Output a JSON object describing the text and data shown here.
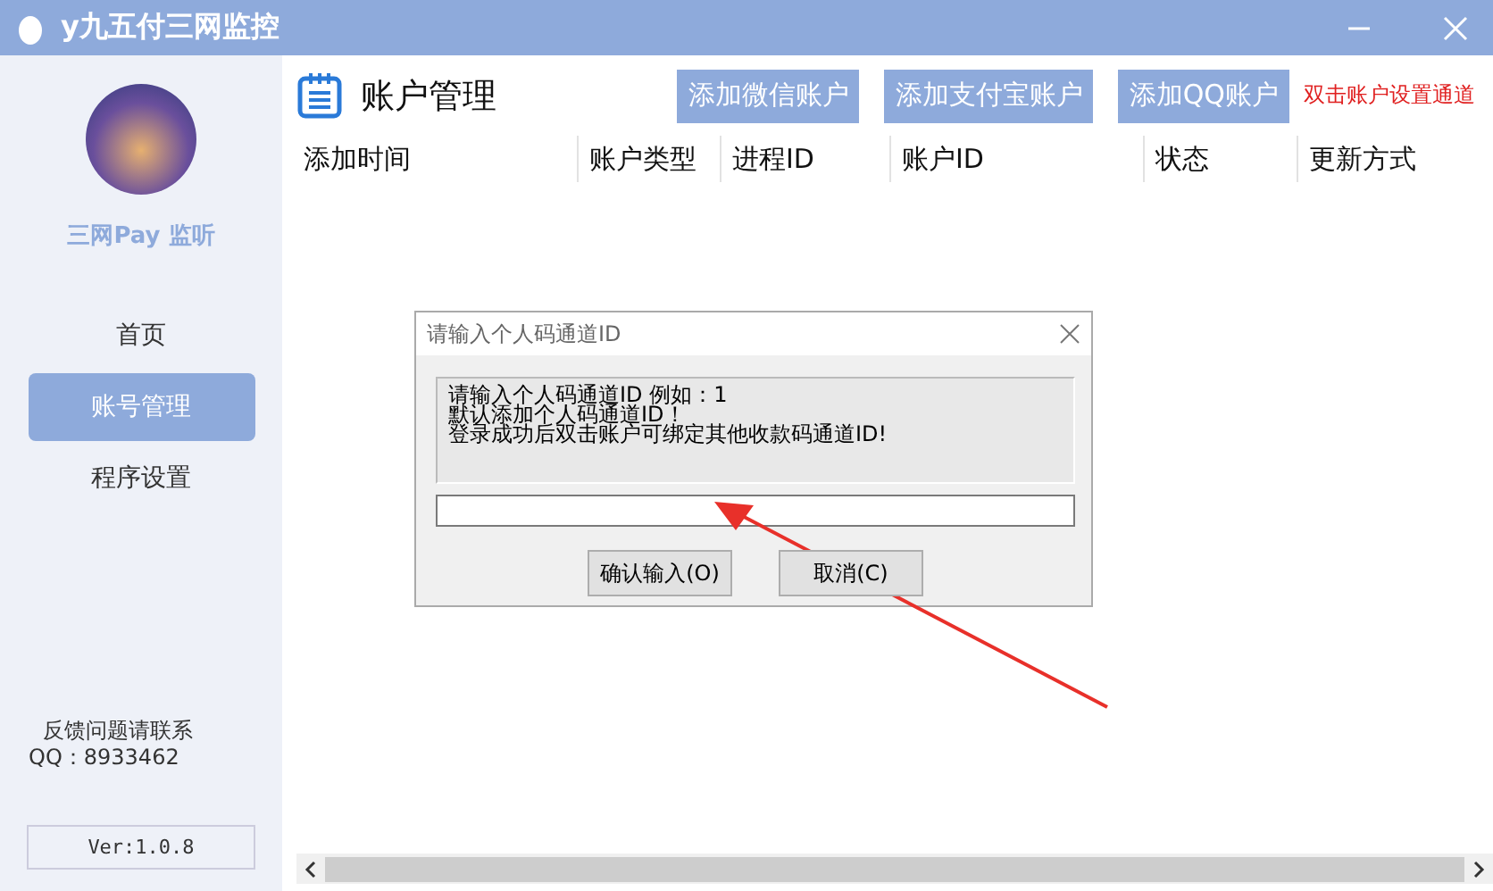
{
  "window": {
    "title": "y九五付三网监控"
  },
  "sidebar": {
    "app_name": "三网Pay 监听",
    "nav": [
      {
        "label": "首页",
        "selected": false
      },
      {
        "label": "账号管理",
        "selected": true
      },
      {
        "label": "程序设置",
        "selected": false
      }
    ],
    "contact": [
      "反馈问题请联系",
      "QQ：8933462"
    ],
    "version": "Ver:1.0.8"
  },
  "main": {
    "title": "账户管理",
    "buttons": [
      "添加微信账户",
      "添加支付宝账户",
      "添加QQ账户"
    ],
    "hint": "双击账户设置通道",
    "table": {
      "columns": [
        "添加时间",
        "账户类型",
        "进程ID",
        "账户ID",
        "状态",
        "更新方式"
      ]
    }
  },
  "dialog": {
    "title": "请输入个人码通道ID",
    "message": [
      "请输入个人码通道ID  例如：1",
      "默认添加个人码通道ID！",
      "登录成功后双击账户可绑定其他收款码通道ID!"
    ],
    "buttons": [
      "确认输入(O)",
      "取消(C)"
    ]
  }
}
